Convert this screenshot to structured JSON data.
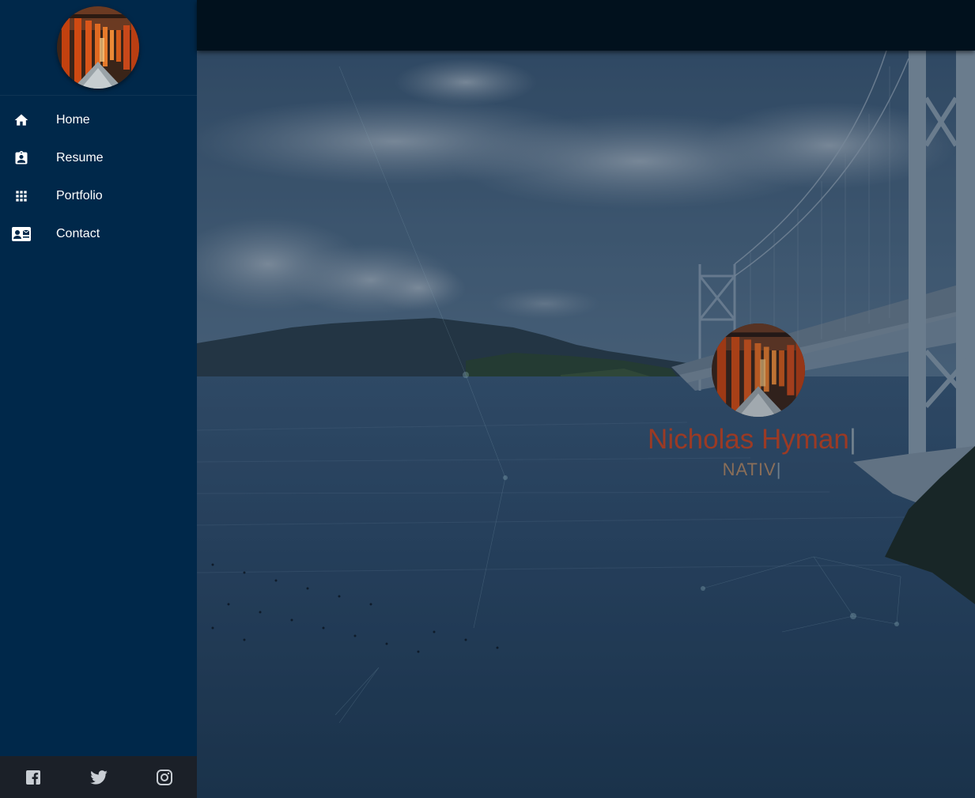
{
  "sidebar": {
    "items": [
      {
        "label": "Home",
        "icon": "home-icon"
      },
      {
        "label": "Resume",
        "icon": "resume-icon"
      },
      {
        "label": "Portfolio",
        "icon": "grid-icon"
      },
      {
        "label": "Contact",
        "icon": "contact-card-icon"
      }
    ],
    "social": [
      {
        "icon": "facebook-icon"
      },
      {
        "icon": "twitter-icon"
      },
      {
        "icon": "instagram-icon"
      }
    ]
  },
  "hero": {
    "name": "Nicholas Hyman",
    "cursor": "|",
    "role": "NATIV"
  },
  "colors": {
    "sidebar_bg": "#00284a",
    "topbar_bg": "#01111d",
    "footer_bg": "#1b2028",
    "name_color": "#9b3a24",
    "role_color": "#8a6e58"
  }
}
